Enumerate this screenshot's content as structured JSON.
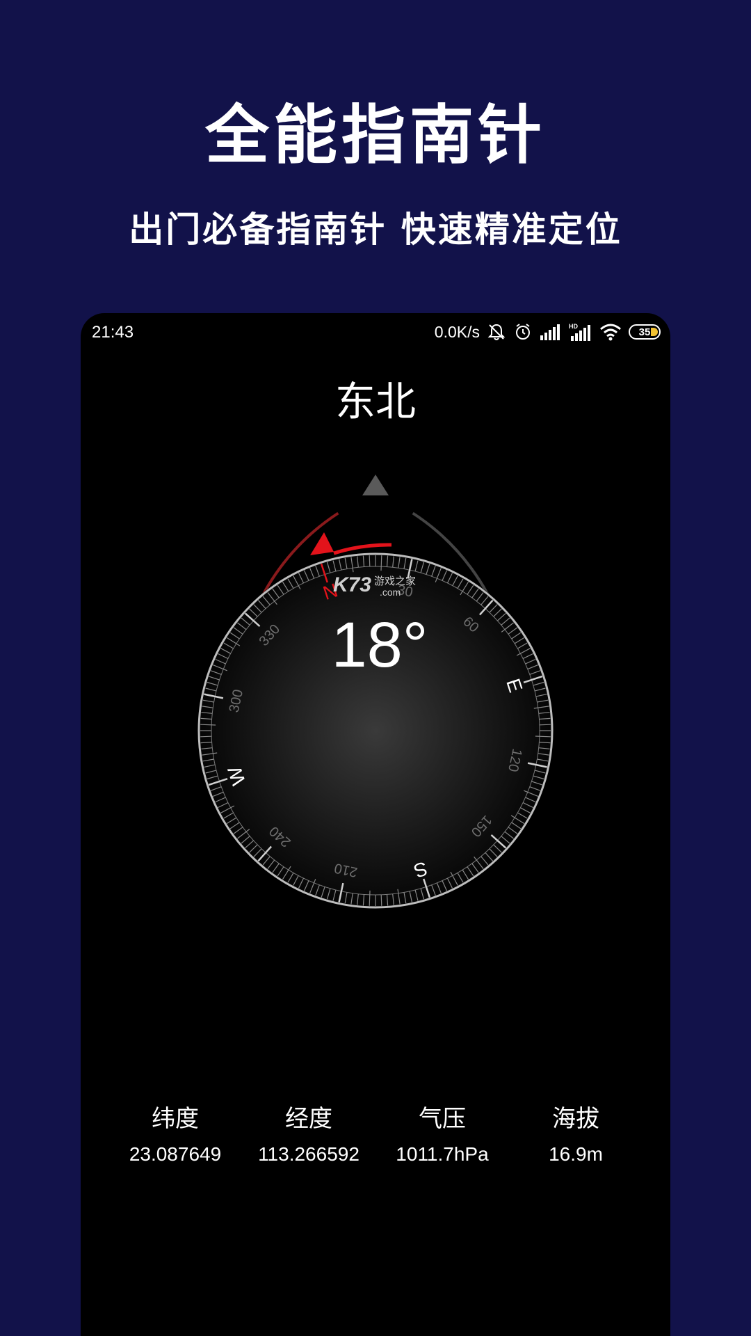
{
  "promo": {
    "title": "全能指南针",
    "subtitle": "出门必备指南针 快速精准定位"
  },
  "status_bar": {
    "time": "21:43",
    "network_speed": "0.0K/s",
    "battery": "35",
    "icons": [
      "mute-bell-icon",
      "alarm-icon",
      "signal-icon",
      "hd-signal-icon",
      "wifi-icon",
      "battery-icon"
    ]
  },
  "compass": {
    "direction": "东北",
    "heading": "18°",
    "heading_degrees": 18,
    "watermark_main": "K73",
    "watermark_sub": "游戏之家",
    "watermark_domain": ".com",
    "cardinals": {
      "n": "N",
      "e": "E",
      "s": "S",
      "w": "W"
    },
    "degree_labels": [
      "30",
      "60",
      "120",
      "150",
      "210",
      "240",
      "300",
      "330"
    ],
    "accent_color": "#e3131b"
  },
  "stats": [
    {
      "label": "纬度",
      "value": "23.087649"
    },
    {
      "label": "经度",
      "value": "113.266592"
    },
    {
      "label": "气压",
      "value": "1011.7hPa"
    },
    {
      "label": "海拔",
      "value": "16.9m"
    }
  ]
}
